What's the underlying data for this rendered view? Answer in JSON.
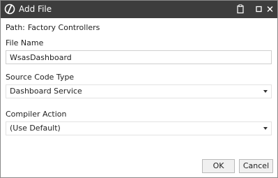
{
  "window": {
    "title": "Add File",
    "logo_icon": "wonderware-slash-logo",
    "controls": [
      "clipboard-icon",
      "maximize-icon",
      "close-icon"
    ],
    "titlebar_color": "#3d3d3d"
  },
  "path": {
    "label": "Path:",
    "value": "Factory Controllers"
  },
  "file_name": {
    "label": "File Name",
    "value": "WsasDashboard"
  },
  "source_code_type": {
    "label": "Source Code Type",
    "selected": "Dashboard Service"
  },
  "compiler_action": {
    "label": "Compiler Action",
    "selected": "(Use Default)"
  },
  "buttons": {
    "ok_label": "OK",
    "cancel_label": "Cancel"
  }
}
